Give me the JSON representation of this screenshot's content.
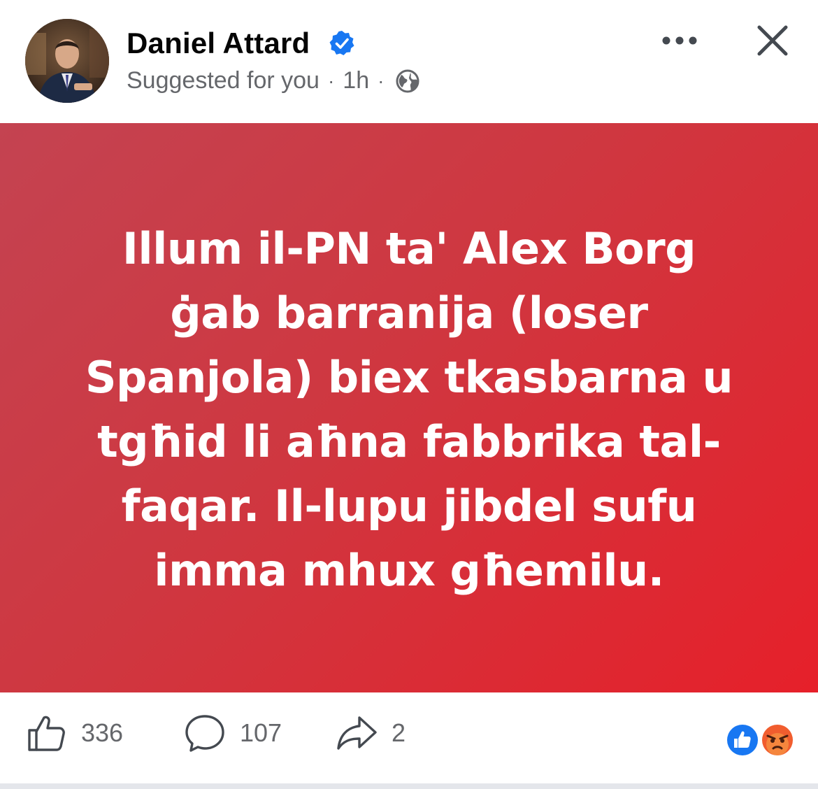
{
  "post": {
    "author": "Daniel Attard",
    "meta": {
      "suggested": "Suggested for you",
      "separator": "·",
      "time": "1h",
      "audience_icon": "globe-icon"
    },
    "header_icons": {
      "verified": "verified-badge-icon",
      "more": "more-icon",
      "close": "close-icon"
    },
    "banner": {
      "text": "Illum il-PN ta' Alex Borg\nġab barranija (loser\nSpanjola) biex tkasbarna u\ntgħid li aħna fabbrika tal-\nfaqar. Il-lupu jibdel sufu\nimma mhux għemilu.",
      "gradient_colors": [
        "#c44351",
        "#cf3740",
        "#e6202a"
      ]
    },
    "actions": {
      "likes": "336",
      "comments": "107",
      "shares": "2"
    },
    "reactions": [
      "like-reaction-icon",
      "angry-reaction-icon"
    ],
    "colors": {
      "verified_blue": "#1877f2",
      "secondary_text": "#65676b",
      "primary_text": "#050505",
      "angry_orange": "#f15d2e"
    }
  }
}
